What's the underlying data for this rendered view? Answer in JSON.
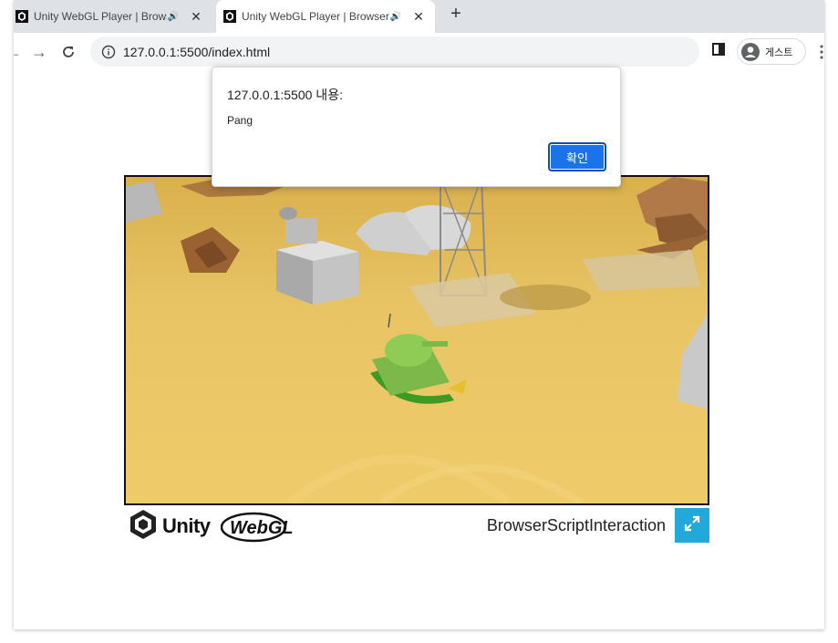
{
  "tabs": [
    {
      "title": "Unity WebGL Player | Browser"
    },
    {
      "title": "Unity WebGL Player | Browser"
    }
  ],
  "toolbar": {
    "url": "127.0.0.1:5500/index.html",
    "profile_label": "게스트"
  },
  "dialog": {
    "title": "127.0.0.1:5500 내용:",
    "message": "Pang",
    "ok_label": "확인"
  },
  "player": {
    "unity_label": "Unity",
    "webgl_label": "WebGL",
    "build_title": "BrowserScriptInteraction"
  },
  "colors": {
    "accent": "#1a73e8",
    "fullscreen_button": "#23a8db",
    "sand": "#e4c15e"
  }
}
